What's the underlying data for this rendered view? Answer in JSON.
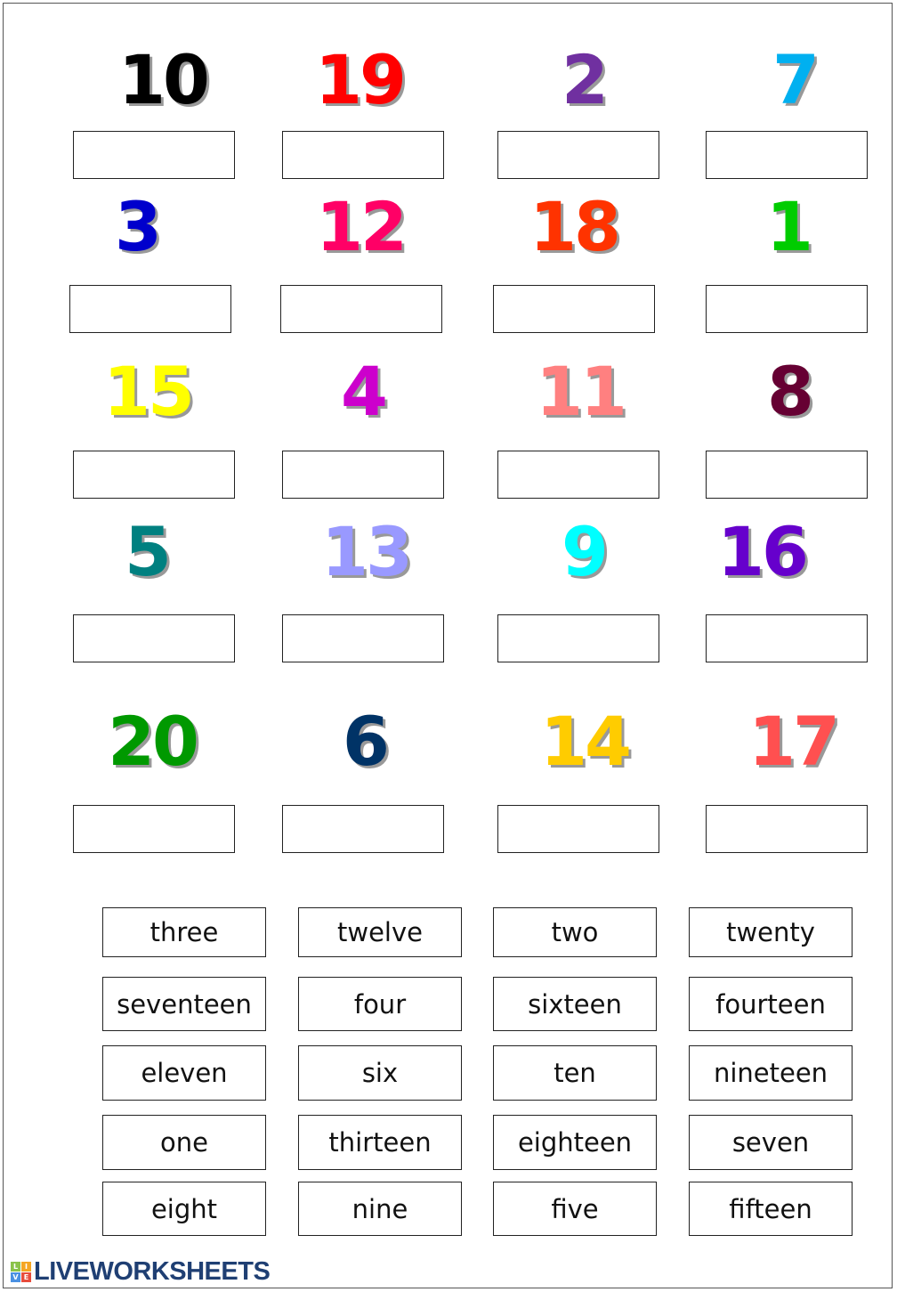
{
  "numbers": [
    {
      "value": "10",
      "color": "#000000"
    },
    {
      "value": "19",
      "color": "#ff0000"
    },
    {
      "value": "2",
      "color": "#7030a0"
    },
    {
      "value": "7",
      "color": "#00b0f0"
    },
    {
      "value": "3",
      "color": "#0000cc"
    },
    {
      "value": "12",
      "color": "#ff0066"
    },
    {
      "value": "18",
      "color": "#ff3300"
    },
    {
      "value": "1",
      "color": "#00cc00"
    },
    {
      "value": "15",
      "color": "#ffff00"
    },
    {
      "value": "4",
      "color": "#cc00cc"
    },
    {
      "value": "11",
      "color": "#ff8080"
    },
    {
      "value": "8",
      "color": "#660033"
    },
    {
      "value": "5",
      "color": "#008080"
    },
    {
      "value": "13",
      "color": "#9999ff"
    },
    {
      "value": "9",
      "color": "#00ffff"
    },
    {
      "value": "16",
      "color": "#6600cc"
    },
    {
      "value": "20",
      "color": "#009900"
    },
    {
      "value": "6",
      "color": "#003366"
    },
    {
      "value": "14",
      "color": "#ffcc00"
    },
    {
      "value": "17",
      "color": "#ff5050"
    }
  ],
  "answers": [
    "",
    "",
    "",
    "",
    "",
    "",
    "",
    "",
    "",
    "",
    "",
    "",
    "",
    "",
    "",
    "",
    "",
    "",
    "",
    ""
  ],
  "words": [
    "three",
    "twelve",
    "two",
    "twenty",
    "seventeen",
    "four",
    "sixteen",
    "fourteen",
    "eleven",
    "six",
    "ten",
    "nineteen",
    "one",
    "thirteen",
    "eighteen",
    "seven",
    "eight",
    "nine",
    "five",
    "fifteen"
  ],
  "logo": {
    "text": "LIVEWORKSHEETS",
    "badge": "LIVE"
  }
}
